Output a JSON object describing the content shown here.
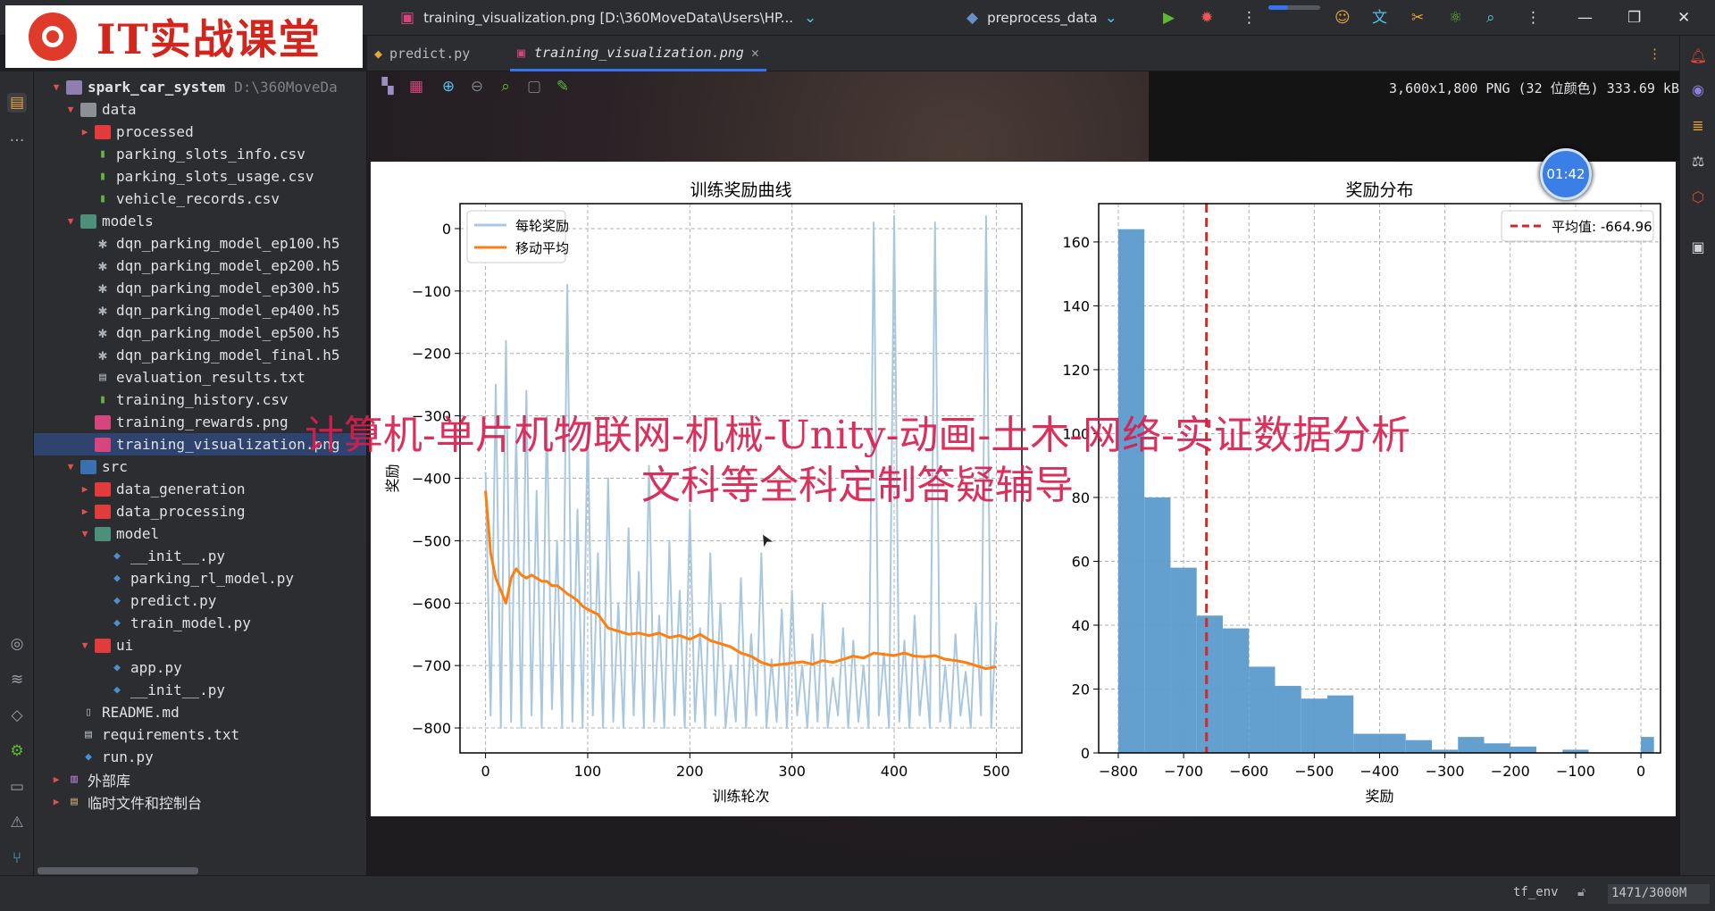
{
  "titlebar": {
    "logo_text": "IT实战课堂",
    "file_title": "training_visualization.png [D:\\360MoveData\\Users\\HP...",
    "run_config": "preprocess_data"
  },
  "tabs": [
    {
      "label": "predict.py"
    },
    {
      "label": "training_visualization.png"
    }
  ],
  "image_info": "3,600x1,800 PNG (32 位颜色) 333.69 kB",
  "timer": "01:42",
  "watermark": {
    "line1": "计算机-单片机物联网-机械-Unity-动画-土木-网络-实证数据分析",
    "line2": "文科等全科定制答疑辅导"
  },
  "project": {
    "root_name": "spark_car_system",
    "root_path": "D:\\360MoveDa",
    "rows": [
      {
        "label": "data"
      },
      {
        "label": "processed"
      },
      {
        "label": "parking_slots_info.csv"
      },
      {
        "label": "parking_slots_usage.csv"
      },
      {
        "label": "vehicle_records.csv"
      },
      {
        "label": "models"
      },
      {
        "label": "dqn_parking_model_ep100.h5"
      },
      {
        "label": "dqn_parking_model_ep200.h5"
      },
      {
        "label": "dqn_parking_model_ep300.h5"
      },
      {
        "label": "dqn_parking_model_ep400.h5"
      },
      {
        "label": "dqn_parking_model_ep500.h5"
      },
      {
        "label": "dqn_parking_model_final.h5"
      },
      {
        "label": "evaluation_results.txt"
      },
      {
        "label": "training_history.csv"
      },
      {
        "label": "training_rewards.png"
      },
      {
        "label": "training_visualization.png"
      },
      {
        "label": "src"
      },
      {
        "label": "data_generation"
      },
      {
        "label": "data_processing"
      },
      {
        "label": "model"
      },
      {
        "label": "__init__.py"
      },
      {
        "label": "parking_rl_model.py"
      },
      {
        "label": "predict.py"
      },
      {
        "label": "train_model.py"
      },
      {
        "label": "ui"
      },
      {
        "label": "app.py"
      },
      {
        "label": "__init__.py"
      },
      {
        "label": "README.md"
      },
      {
        "label": "requirements.txt"
      },
      {
        "label": "run.py"
      },
      {
        "label": "外部库"
      },
      {
        "label": "临时文件和控制台"
      }
    ]
  },
  "statusbar": {
    "env": "tf_env",
    "memory": "1471/3000M"
  },
  "colors": {
    "raw_line": "#a9c8e0",
    "avg_line": "#ff7f0e",
    "hist_bar": "#5b9bcd",
    "mean_line": "#d62728",
    "accent": "#3574f0"
  },
  "chart_data": [
    {
      "type": "line",
      "title": "训练奖励曲线",
      "xlabel": "训练轮次",
      "ylabel": "奖励",
      "xlim": [
        -25,
        525
      ],
      "ylim": [
        -840,
        40
      ],
      "xticks": [
        0,
        100,
        200,
        300,
        400,
        500
      ],
      "yticks": [
        0,
        -100,
        -200,
        -300,
        -400,
        -500,
        -600,
        -700,
        -800
      ],
      "legend": "upper-left",
      "grid": true,
      "series": [
        {
          "name": "每轮奖励",
          "x": [
            0,
            5,
            10,
            15,
            20,
            25,
            30,
            35,
            40,
            45,
            50,
            55,
            60,
            65,
            70,
            75,
            80,
            85,
            90,
            95,
            100,
            105,
            110,
            115,
            120,
            125,
            130,
            135,
            140,
            145,
            150,
            155,
            160,
            165,
            170,
            175,
            180,
            185,
            190,
            195,
            200,
            205,
            210,
            215,
            220,
            225,
            230,
            235,
            240,
            245,
            250,
            255,
            260,
            265,
            270,
            275,
            280,
            285,
            290,
            295,
            300,
            305,
            310,
            315,
            320,
            325,
            330,
            335,
            340,
            345,
            350,
            355,
            360,
            365,
            370,
            375,
            380,
            385,
            390,
            395,
            400,
            405,
            410,
            415,
            420,
            425,
            430,
            435,
            440,
            445,
            450,
            455,
            460,
            465,
            470,
            475,
            480,
            485,
            490,
            495,
            500
          ],
          "values": [
            -390,
            -780,
            -250,
            -800,
            -180,
            -790,
            -320,
            -800,
            -260,
            -780,
            -420,
            -800,
            -300,
            -770,
            -500,
            -800,
            -90,
            -790,
            -450,
            -800,
            -310,
            -780,
            -520,
            -800,
            -400,
            -790,
            -600,
            -800,
            -480,
            -780,
            -550,
            -800,
            -380,
            -790,
            -620,
            -800,
            -500,
            -780,
            -580,
            -800,
            -450,
            -790,
            -640,
            -800,
            -520,
            -780,
            -600,
            -800,
            -700,
            -790,
            -560,
            -800,
            -650,
            -780,
            -520,
            -800,
            -690,
            -790,
            -610,
            -800,
            -580,
            -780,
            -700,
            -800,
            -650,
            -790,
            -600,
            -800,
            -720,
            -780,
            -640,
            -800,
            -660,
            -790,
            -700,
            -800,
            10,
            -780,
            -680,
            -800,
            20,
            -790,
            -660,
            -800,
            -620,
            -780,
            -690,
            -800,
            10,
            -790,
            -700,
            -800,
            -650,
            -780,
            -710,
            -800,
            -600,
            -780,
            20,
            -800,
            -630
          ],
          "color": "#a9c8e0"
        },
        {
          "name": "移动平均",
          "x": [
            0,
            5,
            10,
            15,
            20,
            25,
            30,
            35,
            40,
            45,
            50,
            55,
            60,
            65,
            70,
            75,
            80,
            85,
            90,
            95,
            100,
            110,
            120,
            130,
            140,
            150,
            160,
            170,
            180,
            190,
            200,
            210,
            220,
            230,
            240,
            250,
            260,
            270,
            280,
            290,
            300,
            310,
            320,
            330,
            340,
            350,
            360,
            370,
            380,
            390,
            400,
            410,
            420,
            430,
            440,
            450,
            460,
            470,
            480,
            490,
            500
          ],
          "values": [
            -420,
            -520,
            -560,
            -580,
            -600,
            -560,
            -545,
            -555,
            -560,
            -555,
            -560,
            -565,
            -565,
            -572,
            -572,
            -578,
            -585,
            -590,
            -596,
            -605,
            -610,
            -618,
            -640,
            -645,
            -650,
            -648,
            -652,
            -648,
            -655,
            -652,
            -658,
            -650,
            -660,
            -665,
            -670,
            -680,
            -685,
            -695,
            -700,
            -698,
            -696,
            -694,
            -698,
            -692,
            -695,
            -690,
            -685,
            -688,
            -680,
            -682,
            -684,
            -680,
            -685,
            -686,
            -684,
            -690,
            -692,
            -695,
            -700,
            -705,
            -702
          ],
          "color": "#ff7f0e"
        }
      ]
    },
    {
      "type": "bar",
      "title": "奖励分布",
      "xlabel": "奖励",
      "ylabel": "",
      "xlim": [
        -830,
        30
      ],
      "ylim": [
        0,
        172
      ],
      "xticks": [
        -800,
        -700,
        -600,
        -500,
        -400,
        -300,
        -200,
        -100,
        0
      ],
      "yticks": [
        0,
        20,
        40,
        60,
        80,
        100,
        120,
        140,
        160
      ],
      "legend": "upper-right",
      "grid": true,
      "bin_edges": [
        -800,
        -760,
        -720,
        -680,
        -640,
        -600,
        -560,
        -520,
        -480,
        -440,
        -400,
        -360,
        -320,
        -280,
        -240,
        -200,
        -160,
        -120,
        -80,
        -40,
        0,
        20
      ],
      "values": [
        164,
        80,
        58,
        43,
        39,
        27,
        21,
        17,
        18,
        6,
        6,
        4,
        1,
        5,
        3,
        2,
        0,
        1,
        0,
        0,
        5
      ],
      "mean": -664.96,
      "mean_label": "平均值: -664.96"
    }
  ]
}
